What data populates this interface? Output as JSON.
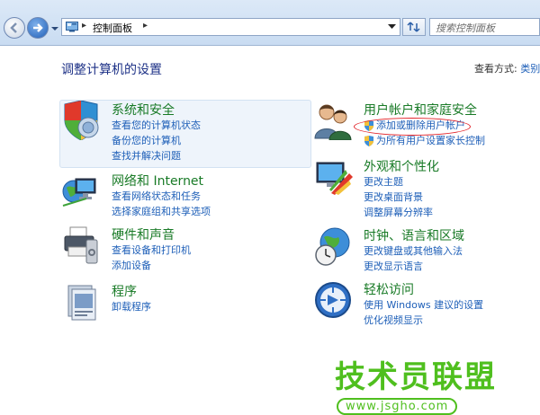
{
  "address_bar": {
    "breadcrumb": "控制面板",
    "search_placeholder": "搜索控制面板"
  },
  "header": {
    "title": "调整计算机的设置",
    "view_by_label": "查看方式:",
    "view_by_value": "类别"
  },
  "categories": {
    "system_security": {
      "title": "系统和安全",
      "links": [
        "查看您的计算机状态",
        "备份您的计算机",
        "查找并解决问题"
      ]
    },
    "network": {
      "title": "网络和 Internet",
      "links": [
        "查看网络状态和任务",
        "选择家庭组和共享选项"
      ]
    },
    "hardware": {
      "title": "硬件和声音",
      "links": [
        "查看设备和打印机",
        "添加设备"
      ]
    },
    "programs": {
      "title": "程序",
      "links": [
        "卸载程序"
      ]
    },
    "user_accounts": {
      "title": "用户帐户和家庭安全",
      "links": [
        "添加或删除用户帐户",
        "为所有用户设置家长控制"
      ]
    },
    "appearance": {
      "title": "外观和个性化",
      "links": [
        "更改主题",
        "更改桌面背景",
        "调整屏幕分辨率"
      ]
    },
    "clock_region": {
      "title": "时钟、语言和区域",
      "links": [
        "更改键盘或其他输入法",
        "更改显示语言"
      ]
    },
    "ease_of_access": {
      "title": "轻松访问",
      "links": [
        "使用 Windows 建议的设置",
        "优化视频显示"
      ]
    }
  },
  "watermark": {
    "text": "技术员联盟",
    "url": "www.jsgho.com"
  },
  "colors": {
    "category_title": "#187a26",
    "link": "#1e5fb8",
    "annotation": "#e2242a",
    "watermark": "#4fbf1e"
  }
}
